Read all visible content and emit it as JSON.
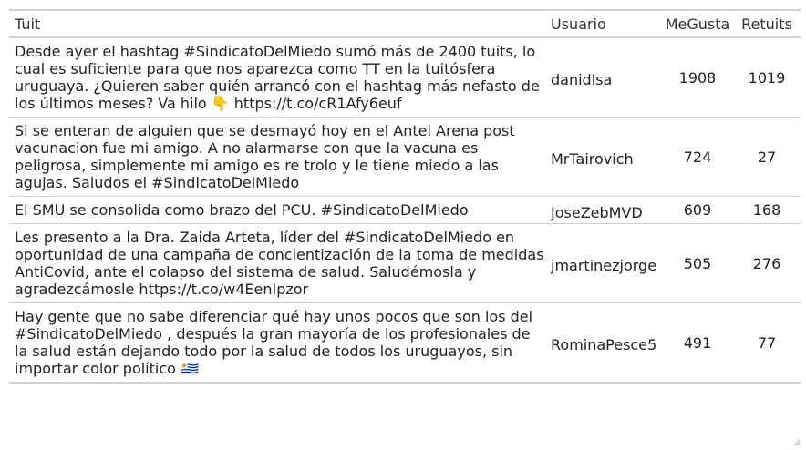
{
  "columns": {
    "tweet": "Tuit",
    "user": "Usuario",
    "likes": "MeGusta",
    "retweets": "Retuits"
  },
  "rows": [
    {
      "tweet": "Desde ayer el hashtag #SindicatoDelMiedo sumó más de 2400 tuits, lo cual es suficiente para que nos aparezca como TT en la tuitósfera uruguaya. ¿Quieren saber quién arrancó con el hashtag más nefasto de los últimos meses? Va hilo 👇 https://t.co/cR1Afy6euf",
      "user": "danidlsa",
      "likes": "1908",
      "retweets": "1019"
    },
    {
      "tweet": "Si se enteran de alguien que se desmayó hoy en el Antel Arena post vacunacion fue mi amigo. A no alarmarse con que la vacuna es peligrosa, simplemente mi amigo es re trolo y le tiene miedo a las agujas. Saludos el #SindicatoDelMiedo",
      "user": "MrTairovich",
      "likes": "724",
      "retweets": "27"
    },
    {
      "tweet": "El SMU se consolida como brazo del PCU. #SindicatoDelMiedo",
      "user": "JoseZebMVD",
      "likes": "609",
      "retweets": "168"
    },
    {
      "tweet": "Les presento a la Dra. Zaida Arteta, líder del #SindicatoDelMiedo en oportunidad de una campaña de concientización de la toma de medidas AntiCovid, ante el colapso del sistema de salud. Saludémosla y agradezcámosle https://t.co/w4EenIpzor",
      "user": "jmartinezjorge",
      "likes": "505",
      "retweets": "276"
    },
    {
      "tweet": "Hay gente que no sabe diferenciar qué hay unos pocos que son los del #SindicatoDelMiedo , después la gran mayoría de los profesionales de la salud están dejando todo por la salud de todos los uruguayos, sin importar color político 🇺🇾",
      "user": "RominaPesce5",
      "likes": "491",
      "retweets": "77"
    }
  ],
  "icons": {
    "resize_grip": "resize-grip-icon"
  }
}
